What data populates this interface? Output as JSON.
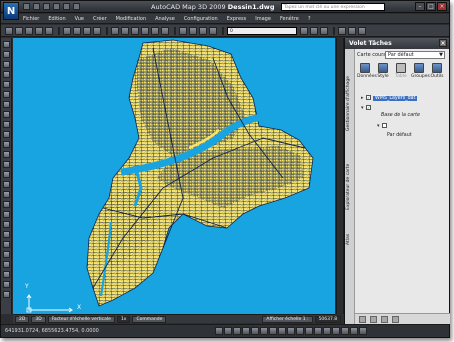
{
  "app": {
    "logo_letter": "N",
    "title_app": "AutoCAD Map 3D 2009",
    "title_file": "Dessin1.dwg"
  },
  "search": {
    "placeholder": "Tapez un mot clé ou une expression"
  },
  "window_buttons": [
    "–",
    "□",
    "×"
  ],
  "menu": [
    "Fichier",
    "Edition",
    "Vue",
    "Créer",
    "Modification",
    "Analyse",
    "Configuration",
    "Express",
    "Image",
    "Fenêtre",
    "?"
  ],
  "toolbar": {
    "layer_value": "0"
  },
  "canvas": {
    "background_color": "#18a4e0",
    "land_color": "#f6e36e",
    "line_color": "#10244a"
  },
  "ucs": {
    "x_label": "X",
    "y_label": "Y"
  },
  "model_tabs": {
    "tab_2d": "2D",
    "tab_3d": "3D",
    "vertical_scale_label": "Facteur d'échelle verticale",
    "vertical_scale_value": "1x",
    "commande_label": "Commande",
    "scale_button": "Afficher échelle 1 :",
    "scale_value": "50637.8"
  },
  "status": {
    "coordinates": "641931.0724, 6855623.4754, 0.0000"
  },
  "palette": {
    "title": "Volet Tâches",
    "close": "×",
    "vtabs": [
      "Gestionnaire d'affichage",
      "Explorateur de carte",
      "Atlas"
    ],
    "carte_label": "Carte courante:",
    "carte_value": "Par défaut",
    "buttons": [
      {
        "label": "Données",
        "enabled": true
      },
      {
        "label": "Style",
        "enabled": true
      },
      {
        "label": "Table",
        "enabled": false
      },
      {
        "label": "Groupes",
        "enabled": true
      },
      {
        "label": "Outils",
        "enabled": true
      }
    ],
    "tree": {
      "layer_item": "WMS_Layers_dat",
      "base_item": "Base de la carte",
      "default_item": "Par défaut"
    }
  }
}
